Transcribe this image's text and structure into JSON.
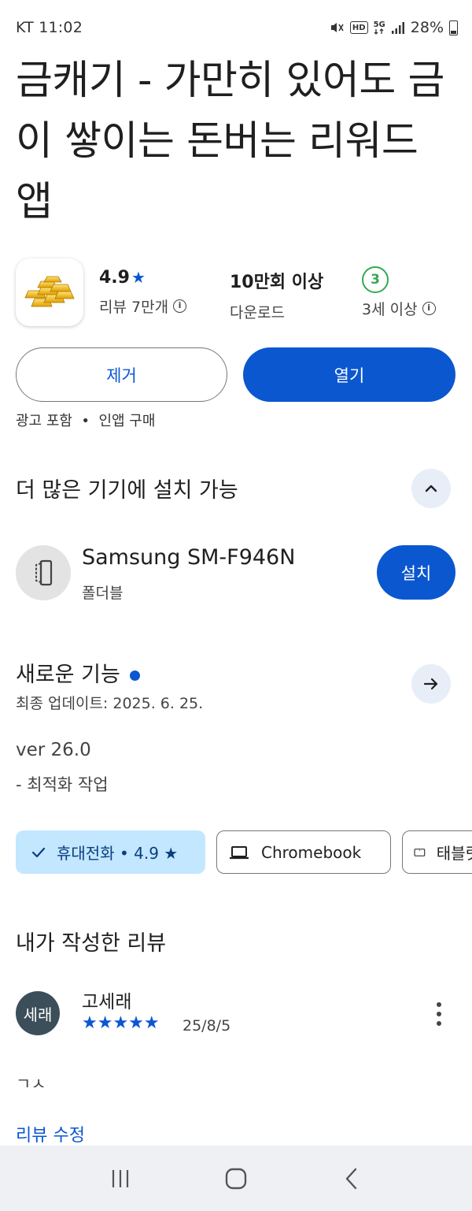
{
  "status_bar": {
    "carrier_time": "KT 11:02",
    "hd_label": "HD",
    "network_label": "5G",
    "battery": "28%"
  },
  "app": {
    "title": "금캐기 - 가만히 있어도 금이 쌓이는 돈버는 리워드 앱",
    "rating": "4.9",
    "rating_star": "★",
    "reviews_label": "리뷰 7만개",
    "downloads_value": "10만회 이상",
    "downloads_label": "다운로드",
    "age_badge": "3",
    "age_label": "3세 이상",
    "icon_name": "gold-bars-icon"
  },
  "actions": {
    "uninstall_label": "제거",
    "open_label": "열기",
    "ads_iap": "광고 포함  •  인앱 구매"
  },
  "devices_section": {
    "title": "더 많은 기기에 설치 가능",
    "device_name": "Samsung SM-F946N",
    "device_type": "폴더블",
    "install_label": "설치"
  },
  "whats_new": {
    "title": "새로운 기능",
    "updated": "최종 업데이트: 2025. 6. 25.",
    "version": "ver 26.0",
    "notes": "- 최적화 작업"
  },
  "device_chips": [
    {
      "label": "휴대전화 • 4.9 ★",
      "icon": "check-icon",
      "selected": true
    },
    {
      "label": "Chromebook",
      "icon": "laptop-icon",
      "selected": false
    },
    {
      "label": "태블릿",
      "icon": "tablet-icon",
      "selected": false
    }
  ],
  "my_review": {
    "title": "내가 작성한 리뷰",
    "avatar_text": "세래",
    "reviewer": "고세래",
    "stars": "★★★★★",
    "rating": 5,
    "date": "25/8/5",
    "text": "ㄱㅅ",
    "edit_label": "리뷰 수정"
  },
  "colors": {
    "primary": "#0b57d0",
    "chip_active_bg": "#c2e7ff",
    "age_green": "#34a853",
    "avatar_bg": "#3c4e5a",
    "navbar_bg": "#eef0f4"
  }
}
